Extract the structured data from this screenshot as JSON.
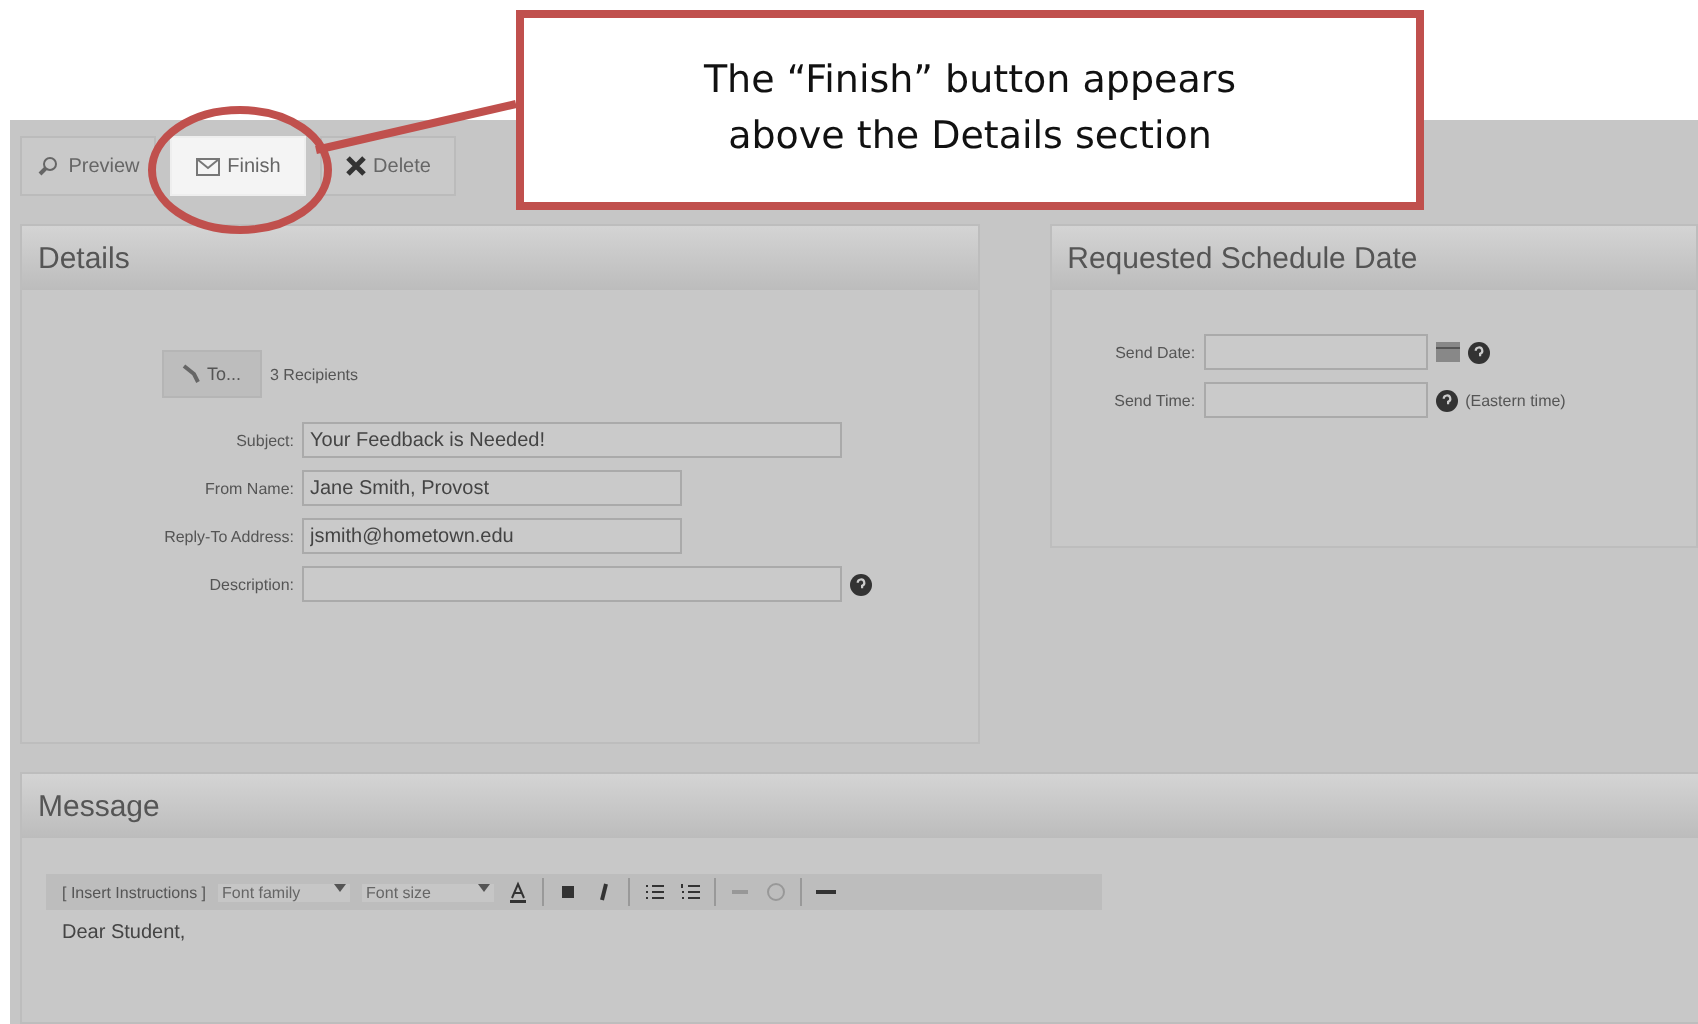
{
  "callout": {
    "lines": [
      "The “Finish” button appears",
      "above the Details section"
    ]
  },
  "toolbar": [
    {
      "label": "Preview",
      "kind": "preview",
      "highlighted": false
    },
    {
      "label": "Finish",
      "kind": "finish",
      "highlighted": true
    },
    {
      "label": "Delete",
      "kind": "delete",
      "highlighted": false
    }
  ],
  "details": {
    "title": "Details",
    "to_button": "To...",
    "recipients": "3 Recipients",
    "fields": [
      {
        "label": "Subject:",
        "value": "Your Feedback is Needed!",
        "wide": true,
        "help": false
      },
      {
        "label": "From Name:",
        "value": "Jane Smith, Provost",
        "wide": false,
        "help": false
      },
      {
        "label": "Reply-To Address:",
        "value": "jsmith@hometown.edu",
        "wide": false,
        "help": false
      },
      {
        "label": "Description:",
        "wide": true,
        "help": true
      }
    ]
  },
  "schedule": {
    "title": "Requested Schedule Date",
    "fields": [
      {
        "label": "Send Date:",
        "calendar": true
      },
      {
        "label": "Send Time:",
        "calendar": false,
        "note": "(Eastern time)"
      }
    ]
  },
  "message": {
    "title": "Message",
    "editor": [
      {
        "kind": "menu",
        "label": "[ Insert Instructions ]"
      },
      {
        "kind": "select",
        "label": "Font family"
      },
      {
        "kind": "select",
        "label": "Font size"
      },
      {
        "kind": "color"
      },
      {
        "kind": "sep"
      },
      {
        "kind": "bold"
      },
      {
        "kind": "italic"
      },
      {
        "kind": "sep"
      },
      {
        "kind": "bullets"
      },
      {
        "kind": "numbers"
      },
      {
        "kind": "sep"
      },
      {
        "kind": "link",
        "disabled": true
      },
      {
        "kind": "unlink",
        "disabled": true
      },
      {
        "kind": "sep"
      },
      {
        "kind": "rule"
      }
    ],
    "body": "Dear Student,"
  }
}
